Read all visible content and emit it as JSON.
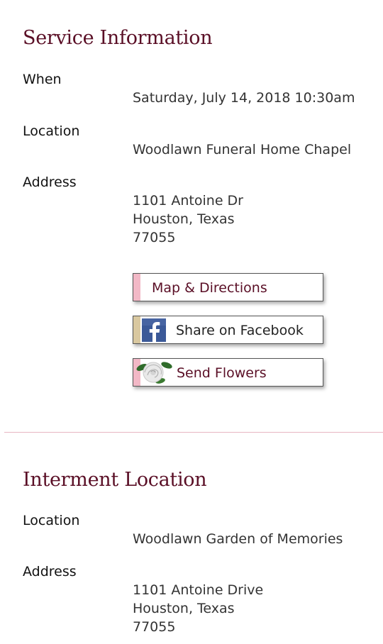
{
  "service": {
    "title": "Service Information",
    "when_label": "When",
    "when_value": "Saturday, July 14, 2018 10:30am",
    "location_label": "Location",
    "location_value": "Woodlawn Funeral Home Chapel",
    "address_label": "Address",
    "address_line1": "1101 Antoine Dr",
    "address_line2": "Houston, Texas",
    "address_line3": "77055"
  },
  "buttons": {
    "map_label": "Map & Directions",
    "facebook_label": "Share on Facebook",
    "flowers_label": "Send Flowers"
  },
  "interment": {
    "title": "Interment Location",
    "location_label": "Location",
    "location_value": "Woodlawn Garden of Memories",
    "address_label": "Address",
    "address_line1": "1101 Antoine Drive",
    "address_line2": "Houston, Texas",
    "address_line3": "77055"
  },
  "colors": {
    "title": "#5a0f26",
    "button_text": "#5a0f26",
    "map_stripe": "#f2b8c6",
    "facebook_stripe": "#d9c8a0",
    "flowers_stripe": "#f2b8c6",
    "divider": "#e7b6c2"
  },
  "icons": {
    "facebook": "facebook-icon",
    "flowers": "rose-icon"
  }
}
